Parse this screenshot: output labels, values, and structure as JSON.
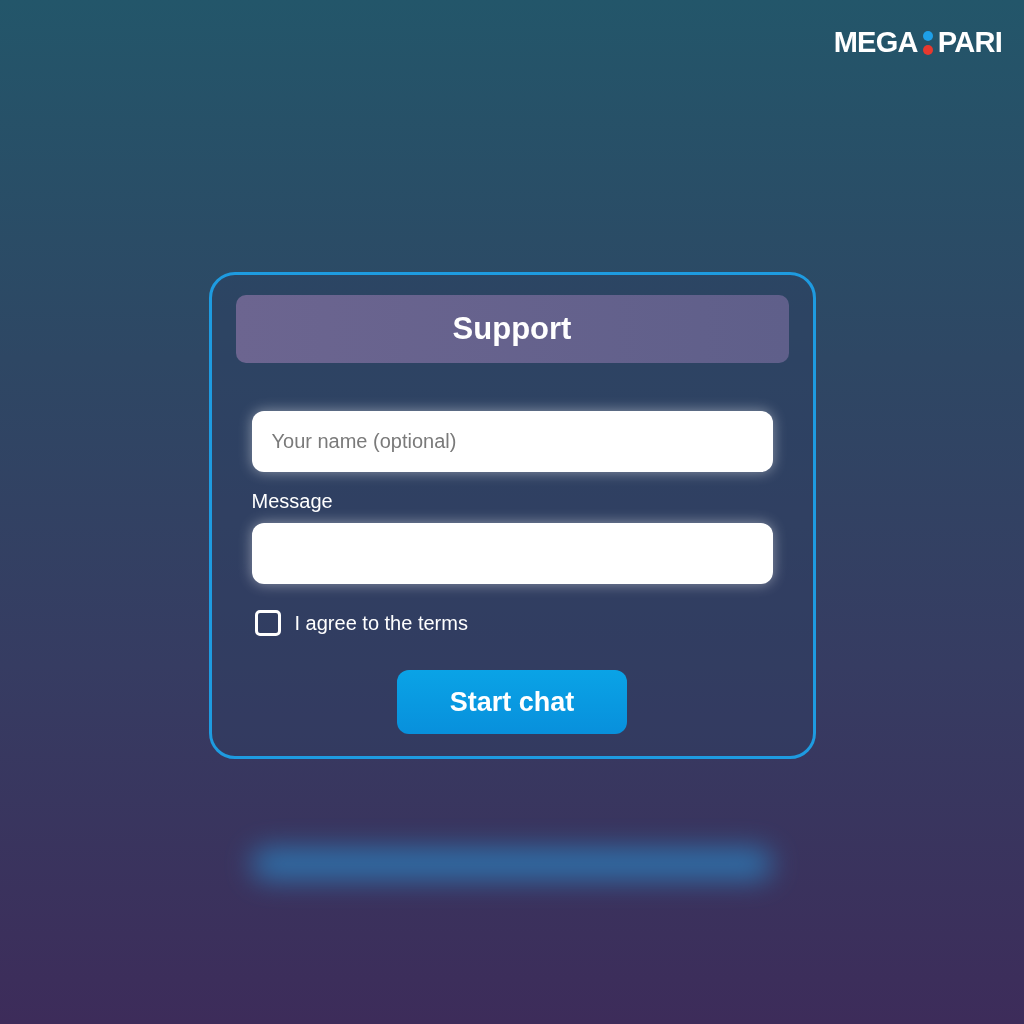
{
  "logo": {
    "left": "MEGA",
    "right": "PARI"
  },
  "form": {
    "title": "Support",
    "name_field": {
      "placeholder": "Your name (optional)"
    },
    "message_label": "Message",
    "terms": {
      "label": "I agree to the terms",
      "checked": false
    },
    "submit": "Start chat"
  }
}
